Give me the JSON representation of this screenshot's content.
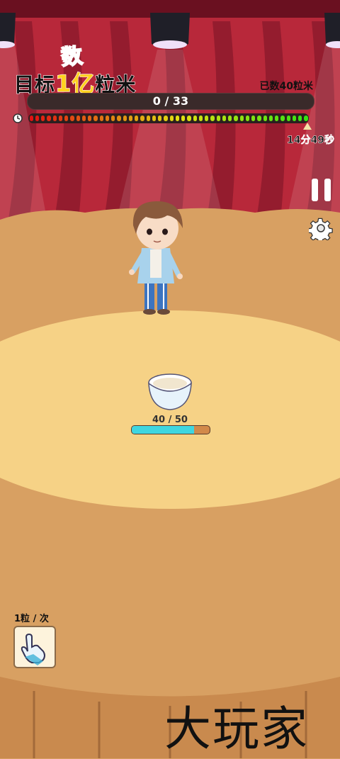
{
  "game": {
    "title_top": "数",
    "title_pre": "目标",
    "title_highlight": "1亿",
    "title_post": "粒米",
    "counted_label": "已数40粒米",
    "progress_text": "0 / 33",
    "progress_fraction": 0.0,
    "time_remaining": "14分49秒",
    "time_fraction_remaining": 0.99,
    "bowl_count_text": "40 / 50",
    "bowl_fraction": 0.8,
    "rate_label": "1粒 / 次",
    "watermark": "大玩家"
  },
  "icons": {
    "pause": "pause-icon",
    "settings": "gear-icon",
    "clock": "clock-icon",
    "tap": "hand-pointer-icon"
  },
  "colors": {
    "curtain": "#b8283a",
    "floor": "#d8a062",
    "stage_circle": "#f6d286",
    "bowl_bar_fill": "#3fd6e0",
    "title_highlight": "#ffd21f",
    "title_top": "#3ec8b4"
  }
}
